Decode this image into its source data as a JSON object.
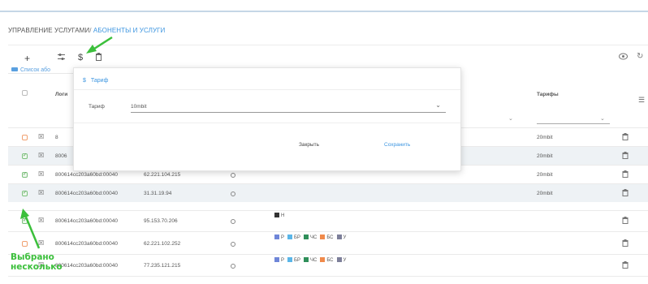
{
  "breadcrumb": {
    "root": "УПРАВЛЕНИЕ УСЛУГАМИ",
    "separator": "/",
    "current": "АБОНЕНТЫ И УСЛУГИ"
  },
  "toolbar": {
    "add": "+",
    "tariff": "$"
  },
  "list_tab": "Список або",
  "columns": {
    "login": "Логи",
    "tariffs": "Тарифы"
  },
  "modal": {
    "title": "Тариф",
    "field_label": "Тариф",
    "field_value": "10mbit",
    "close": "Закрыть",
    "save": "Сохранить"
  },
  "rows": [
    {
      "login": "8",
      "tariff": "20mbit"
    },
    {
      "login": "8006",
      "tariff": "20mbit"
    },
    {
      "login": "800614cc203a60bd:00040",
      "ip": "62.221.104.215",
      "tariff": "20mbit"
    },
    {
      "login": "800614cc203a60bd:00040",
      "ip": "31.31.19.94",
      "tariff": "20mbit"
    },
    {
      "login": "800614cc203a60bd:00040",
      "ip": "95.153.70.206",
      "tariff": ""
    },
    {
      "login": "800614cc203a60bd:00040",
      "ip": "62.221.102.252",
      "tariff": ""
    },
    {
      "login": "800614cc203a60bd:00040",
      "ip": "77.235.121.215",
      "tariff": ""
    }
  ],
  "service_tags": {
    "single": [
      {
        "label": "Н",
        "color": "#333333"
      }
    ],
    "multi": [
      {
        "label": "Р",
        "color": "#6f86d8"
      },
      {
        "label": "БР",
        "color": "#5bb6e8"
      },
      {
        "label": "ЧС",
        "color": "#2f8f5a"
      },
      {
        "label": "БС",
        "color": "#f08a4b"
      },
      {
        "label": "У",
        "color": "#7d7f9a"
      }
    ]
  },
  "annotation": {
    "line1": "Выбрано",
    "line2": "несколько",
    "color": "#3bbf3b"
  }
}
